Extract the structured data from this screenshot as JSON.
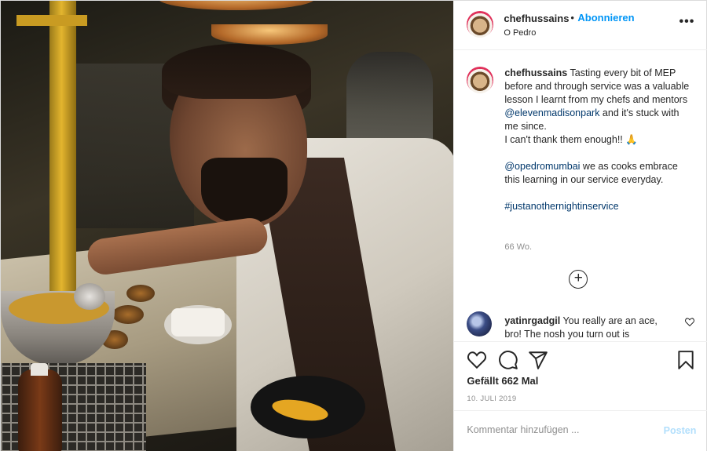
{
  "header": {
    "username": "chefhussains",
    "separator": "•",
    "follow_label": "Abonnieren",
    "location": "O Pedro",
    "more_icon": "more-options-icon",
    "more_glyph": "•••"
  },
  "caption": {
    "username": "chefhussains",
    "line1": "Tasting every bit of MEP before and through service was a valuable lesson I learnt from my chefs and mentors ",
    "mention1": "@elevenmadisonpark",
    "line2": " and it's stuck with me since.",
    "line3": "I can't thank them enough!! 🙏",
    "mention2": "@opedromumbai",
    "line4": " we as cooks embrace this learning in our service everyday.",
    "hashtag": "#justanothernightinservice",
    "time_ago": "66 Wo."
  },
  "load_more": {
    "glyph": "+",
    "icon": "load-more-comments-icon"
  },
  "comment": {
    "username": "yatinrgadgil",
    "text": "You really are an ace, bro! The nosh you turn out is"
  },
  "actions": {
    "like_icon": "heart-icon",
    "comment_icon": "comment-icon",
    "share_icon": "share-icon",
    "save_icon": "bookmark-icon",
    "likes": "Gefällt 662 Mal",
    "date": "10. JULI 2019"
  },
  "add_comment": {
    "placeholder": "Kommentar hinzufügen ...",
    "post_label": "Posten"
  },
  "colors": {
    "link": "#00376b",
    "follow": "#0095f6",
    "post_disabled": "#b2dffc",
    "muted": "#8e8e8e"
  }
}
